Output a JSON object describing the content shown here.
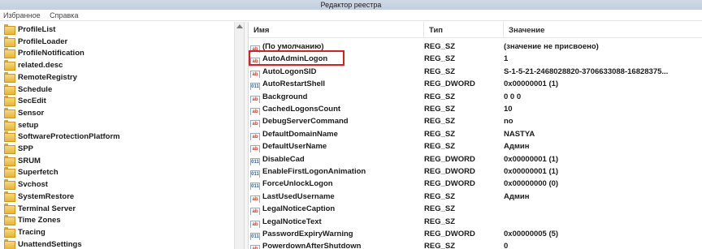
{
  "window": {
    "title": "Редактор реестра"
  },
  "menu": {
    "items": [
      "Избранное",
      "Справка"
    ]
  },
  "tree": {
    "items": [
      "ProfileList",
      "ProfileLoader",
      "ProfileNotification",
      "related.desc",
      "RemoteRegistry",
      "Schedule",
      "SecEdit",
      "Sensor",
      "setup",
      "SoftwareProtectionPlatform",
      "SPP",
      "SRUM",
      "Superfetch",
      "Svchost",
      "SystemRestore",
      "Terminal Server",
      "Time Zones",
      "Tracing",
      "UnattendSettings"
    ]
  },
  "list": {
    "columns": {
      "name": "Имя",
      "type": "Тип",
      "value": "Значение"
    },
    "rows": [
      {
        "icon": "string-value-icon",
        "name": "(По умолчанию)",
        "type": "REG_SZ",
        "value": "(значение не присвоено)"
      },
      {
        "icon": "string-value-icon",
        "name": "AutoAdminLogon",
        "type": "REG_SZ",
        "value": "1"
      },
      {
        "icon": "string-value-icon",
        "name": "AutoLogonSID",
        "type": "REG_SZ",
        "value": "S-1-5-21-2468028820-3706633088-16828375..."
      },
      {
        "icon": "dword-value-icon",
        "name": "AutoRestartShell",
        "type": "REG_DWORD",
        "value": "0x00000001 (1)"
      },
      {
        "icon": "string-value-icon",
        "name": "Background",
        "type": "REG_SZ",
        "value": "0 0 0"
      },
      {
        "icon": "string-value-icon",
        "name": "CachedLogonsCount",
        "type": "REG_SZ",
        "value": "10"
      },
      {
        "icon": "string-value-icon",
        "name": "DebugServerCommand",
        "type": "REG_SZ",
        "value": "no"
      },
      {
        "icon": "string-value-icon",
        "name": "DefaultDomainName",
        "type": "REG_SZ",
        "value": "NASTYA"
      },
      {
        "icon": "string-value-icon",
        "name": "DefaultUserName",
        "type": "REG_SZ",
        "value": "Админ"
      },
      {
        "icon": "dword-value-icon",
        "name": "DisableCad",
        "type": "REG_DWORD",
        "value": "0x00000001 (1)"
      },
      {
        "icon": "dword-value-icon",
        "name": "EnableFirstLogonAnimation",
        "type": "REG_DWORD",
        "value": "0x00000001 (1)"
      },
      {
        "icon": "dword-value-icon",
        "name": "ForceUnlockLogon",
        "type": "REG_DWORD",
        "value": "0x00000000 (0)"
      },
      {
        "icon": "string-value-icon",
        "name": "LastUsedUsername",
        "type": "REG_SZ",
        "value": "Админ"
      },
      {
        "icon": "string-value-icon",
        "name": "LegalNoticeCaption",
        "type": "REG_SZ",
        "value": ""
      },
      {
        "icon": "string-value-icon",
        "name": "LegalNoticeText",
        "type": "REG_SZ",
        "value": ""
      },
      {
        "icon": "dword-value-icon",
        "name": "PasswordExpiryWarning",
        "type": "REG_DWORD",
        "value": "0x00000005 (5)"
      },
      {
        "icon": "string-value-icon",
        "name": "PowerdownAfterShutdown",
        "type": "REG_SZ",
        "value": "0"
      }
    ]
  },
  "annotation": {
    "highlighted_row": "AutoAdminLogon",
    "color": "#e01c1c"
  }
}
